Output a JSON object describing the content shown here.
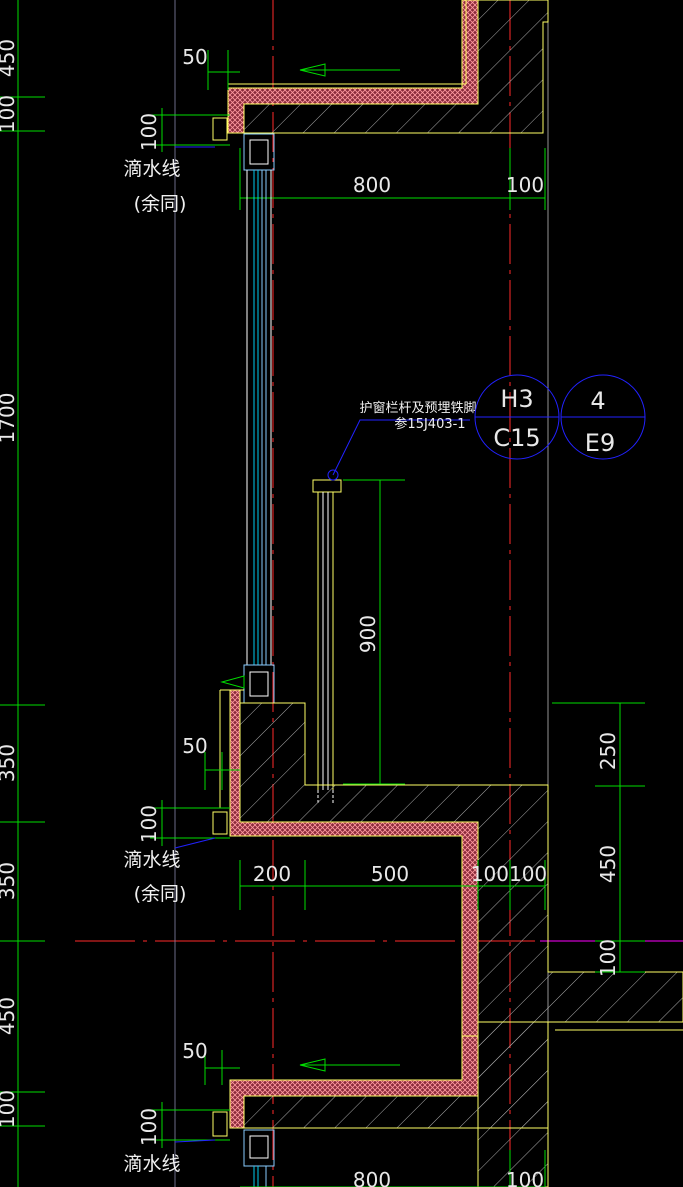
{
  "colors": {
    "background": "#000000",
    "dimension": "#00dd00",
    "axis": "#ff2a2a",
    "wall": "#ffff66",
    "insulation": "#ff6666",
    "glass": "#00ccee",
    "detail": "#2222ff",
    "magenta": "#ff00ff"
  },
  "left_dimensions": [
    "450",
    "100",
    "1700",
    "350",
    "350",
    "450",
    "100"
  ],
  "top_band": {
    "width_50": "50",
    "height_100": "100",
    "drip_label": "滴水线",
    "drip_note": "(余同)",
    "width_800": "800",
    "width_100": "100"
  },
  "middle_band": {
    "width_50": "50",
    "height_100": "100",
    "drip_label": "滴水线",
    "drip_note": "(余同)",
    "width_200": "200",
    "width_500": "500",
    "width_100100": "100100",
    "height_250": "250",
    "height_450": "450"
  },
  "bottom_band": {
    "width_50": "50",
    "height_100": "100",
    "drip_label": "滴水线",
    "width_800": "800",
    "width_100": "100"
  },
  "railing": {
    "note_line1": "护窗栏杆及预埋铁脚",
    "note_line2": "参15J403-1",
    "height_900": "900"
  },
  "callouts": [
    {
      "top": "H3",
      "bottom": "C15"
    },
    {
      "top": "4",
      "bottom": "E9"
    }
  ]
}
